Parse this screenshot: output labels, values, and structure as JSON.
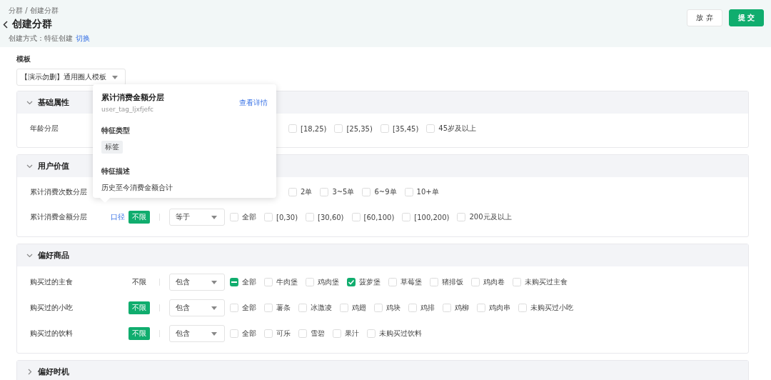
{
  "breadcrumb": "分群 / 创建分群",
  "title": "创建分群",
  "creation_method": {
    "label": "创建方式：特征创建",
    "link": "切换"
  },
  "buttons": [
    {
      "label": "放 弃",
      "kind": "secondary"
    },
    {
      "label": "提 交",
      "kind": "primary"
    }
  ],
  "template": {
    "label": "模板",
    "value": "【演示勿删】通用圈人模板"
  },
  "sections": [
    {
      "title": "基础属性",
      "expanded": true,
      "rows": [
        {
          "label": "年龄分层",
          "options": [
            {
              "label": "[18,25)",
              "checked": false,
              "indeterminate": false
            },
            {
              "label": "[25,35)",
              "checked": false,
              "indeterminate": false
            },
            {
              "label": "[35,45)",
              "checked": false,
              "indeterminate": false
            },
            {
              "label": "45岁及以上",
              "checked": false,
              "indeterminate": false
            }
          ]
        }
      ]
    },
    {
      "title": "用户价值",
      "expanded": true,
      "rows": [
        {
          "label": "累计消费次数分层",
          "options": [
            {
              "label": "2单",
              "checked": false,
              "indeterminate": false
            },
            {
              "label": "3~5单",
              "checked": false,
              "indeterminate": false
            },
            {
              "label": "6~9单",
              "checked": false,
              "indeterminate": false
            },
            {
              "label": "10+单",
              "checked": false,
              "indeterminate": false
            }
          ]
        },
        {
          "label": "累计消费金额分层",
          "link": "口径",
          "badge": {
            "text": "不限",
            "active": true
          },
          "select": "等于",
          "options": [
            {
              "label": "全部",
              "checked": false,
              "indeterminate": false
            },
            {
              "label": "[0,30)",
              "checked": false,
              "indeterminate": false
            },
            {
              "label": "[30,60)",
              "checked": false,
              "indeterminate": false
            },
            {
              "label": "[60,100)",
              "checked": false,
              "indeterminate": false
            },
            {
              "label": "[100,200)",
              "checked": false,
              "indeterminate": false
            },
            {
              "label": "200元及以上",
              "checked": false,
              "indeterminate": false
            }
          ]
        }
      ]
    },
    {
      "title": "偏好商品",
      "expanded": true,
      "rows": [
        {
          "label": "购买过的主食",
          "badge": {
            "text": "不限",
            "active": false
          },
          "select": "包含",
          "options": [
            {
              "label": "全部",
              "checked": false,
              "indeterminate": true
            },
            {
              "label": "牛肉堡",
              "checked": false,
              "indeterminate": false
            },
            {
              "label": "鸡肉堡",
              "checked": false,
              "indeterminate": false
            },
            {
              "label": "菠萝堡",
              "checked": true,
              "indeterminate": false
            },
            {
              "label": "草莓堡",
              "checked": false,
              "indeterminate": false
            },
            {
              "label": "猪排饭",
              "checked": false,
              "indeterminate": false
            },
            {
              "label": "鸡肉卷",
              "checked": false,
              "indeterminate": false
            },
            {
              "label": "未购买过主食",
              "checked": false,
              "indeterminate": false
            }
          ]
        },
        {
          "label": "购买过的小吃",
          "badge": {
            "text": "不限",
            "active": true
          },
          "select": "包含",
          "options": [
            {
              "label": "全部",
              "checked": false,
              "indeterminate": false
            },
            {
              "label": "薯条",
              "checked": false,
              "indeterminate": false
            },
            {
              "label": "冰激凌",
              "checked": false,
              "indeterminate": false
            },
            {
              "label": "鸡翅",
              "checked": false,
              "indeterminate": false
            },
            {
              "label": "鸡块",
              "checked": false,
              "indeterminate": false
            },
            {
              "label": "鸡排",
              "checked": false,
              "indeterminate": false
            },
            {
              "label": "鸡柳",
              "checked": false,
              "indeterminate": false
            },
            {
              "label": "鸡肉串",
              "checked": false,
              "indeterminate": false
            },
            {
              "label": "未购买过小吃",
              "checked": false,
              "indeterminate": false
            }
          ]
        },
        {
          "label": "购买过的饮料",
          "badge": {
            "text": "不限",
            "active": true
          },
          "select": "包含",
          "options": [
            {
              "label": "全部",
              "checked": false,
              "indeterminate": false
            },
            {
              "label": "可乐",
              "checked": false,
              "indeterminate": false
            },
            {
              "label": "雪碧",
              "checked": false,
              "indeterminate": false
            },
            {
              "label": "果汁",
              "checked": false,
              "indeterminate": false
            },
            {
              "label": "未购买过饮料",
              "checked": false,
              "indeterminate": false
            }
          ]
        }
      ]
    },
    {
      "title": "偏好时机",
      "expanded": false
    }
  ],
  "popover": {
    "title": "累计消费金额分层",
    "code": "user_tag_ljxfjefc",
    "link": "查看详情",
    "type_label": "特征类型",
    "type_value": "标签",
    "desc_label": "特征描述",
    "desc_value": "历史至今消费金额合计"
  }
}
